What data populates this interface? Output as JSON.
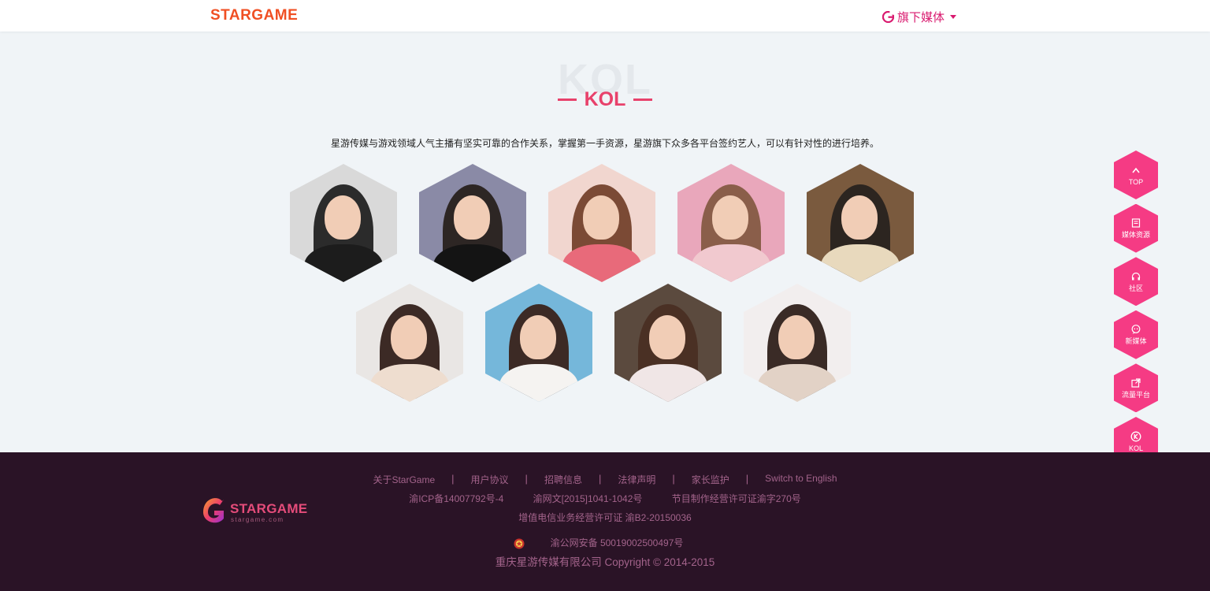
{
  "header": {
    "logo": "STARGAME",
    "media_menu": "旗下媒体"
  },
  "section": {
    "title_bg": "KOL",
    "title": "KOL",
    "description": "星游传媒与游戏领域人气主播有坚实可靠的合作关系，掌握第一手资源，星游旗下众多各平台签约艺人，可以有针对性的进行培养。"
  },
  "kol_cards": [
    {
      "bg": "#d9d9d9",
      "hair": "#2b2b2b",
      "body": "#1c1c1c"
    },
    {
      "bg": "#8a8aa6",
      "hair": "#2d2624",
      "body": "#141414"
    },
    {
      "bg": "#f1d6cf",
      "hair": "#7b4a35",
      "body": "#e86a7a"
    },
    {
      "bg": "#e9a7bb",
      "hair": "#8a5e4a",
      "body": "#f1c9cf"
    },
    {
      "bg": "#7a5a3e",
      "hair": "#2c2520",
      "body": "#e8d9bd"
    },
    {
      "bg": "#e9e6e4",
      "hair": "#3c2a25",
      "body": "#eeddcf"
    },
    {
      "bg": "#75b7da",
      "hair": "#3c2a25",
      "body": "#f5f3f1"
    },
    {
      "bg": "#5b4a3e",
      "hair": "#4a3024",
      "body": "#f0e6e6"
    },
    {
      "bg": "#f2eeee",
      "hair": "#3a2b26",
      "body": "#e2d2c6"
    }
  ],
  "sidebar": [
    {
      "label": "TOP",
      "icon": "up-arrow-icon"
    },
    {
      "label": "媒体资源",
      "icon": "book-icon"
    },
    {
      "label": "社区",
      "icon": "headset-icon"
    },
    {
      "label": "新媒体",
      "icon": "chat-icon"
    },
    {
      "label": "流量平台",
      "icon": "share-icon"
    },
    {
      "label": "KOL",
      "icon": "kol-icon"
    }
  ],
  "footer": {
    "logo": "STARGAME",
    "logo_sub": "stargame.com",
    "links": [
      "关于StarGame",
      "用户协议",
      "招聘信息",
      "法律声明",
      "家长监护",
      "Switch to English"
    ],
    "separator": "|",
    "license_row": [
      "渝ICP备14007792号-4",
      "渝网文[2015]1041-1042号",
      "节目制作经营许可证渝字270号"
    ],
    "telecom": "增值电信业务经营许可证 渝B2-20150036",
    "police": "渝公网安备 50019002500497号",
    "copyright": "重庆星游传媒有限公司 Copyright © 2014-2015"
  },
  "colors": {
    "accent": "#e8416b",
    "side_button": "#f53b84",
    "footer_bg": "#2a1326",
    "footer_text": "#a3638b"
  }
}
